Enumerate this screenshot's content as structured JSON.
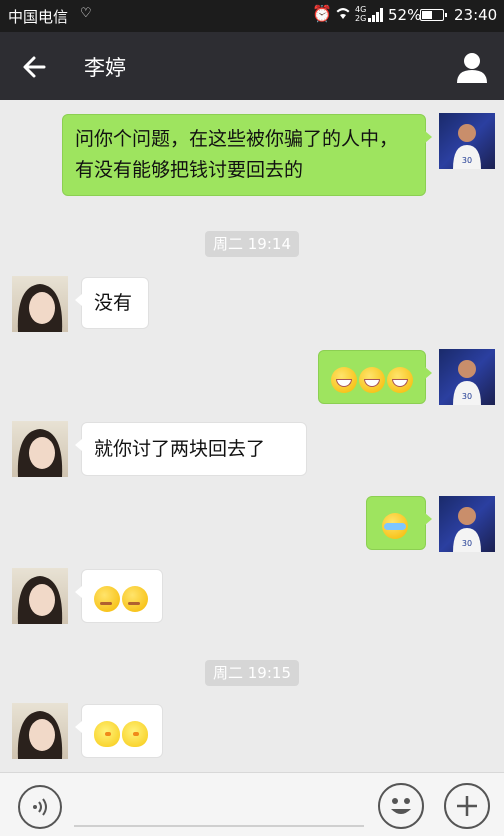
{
  "status_bar": {
    "carrier": "中国电信",
    "network": "4G",
    "network_sub": "2G",
    "battery": "52%",
    "battery_level": 0.52,
    "time": "23:40",
    "icons": [
      "heart-monitor-icon",
      "alarm-icon",
      "wifi-icon",
      "signal-icon",
      "battery-icon"
    ]
  },
  "header": {
    "title": "李婷",
    "back_icon": "back-arrow-icon",
    "profile_icon": "person-icon"
  },
  "messages": [
    {
      "side": "out",
      "type": "text",
      "text": "问你个问题，在这些被你骗了的人中，有没有能够把钱讨要回去的"
    },
    {
      "type": "timestamp",
      "text": "周二 19:14"
    },
    {
      "side": "in",
      "type": "text",
      "text": "没有"
    },
    {
      "side": "out",
      "type": "emoji",
      "emoji": [
        "grin-emoji",
        "grin-emoji",
        "grin-emoji"
      ]
    },
    {
      "side": "in",
      "type": "text",
      "text": "就你讨了两块回去了"
    },
    {
      "side": "out",
      "type": "emoji",
      "emoji": [
        "cry-emoji"
      ]
    },
    {
      "side": "in",
      "type": "emoji",
      "emoji": [
        "smug-emoji",
        "smug-emoji"
      ]
    },
    {
      "type": "timestamp",
      "text": "周二 19:15"
    },
    {
      "side": "in",
      "type": "emoji",
      "emoji": [
        "chick-emoji",
        "chick-emoji"
      ]
    }
  ],
  "input_bar": {
    "voice_icon": "voice-icon",
    "emoji_icon": "emoji-icon",
    "plus_icon": "plus-icon"
  },
  "colors": {
    "outgoing_bubble": "#9ee45f",
    "incoming_bubble": "#ffffff",
    "header_bg": "#2d2d32",
    "chat_bg": "#ebebeb"
  }
}
